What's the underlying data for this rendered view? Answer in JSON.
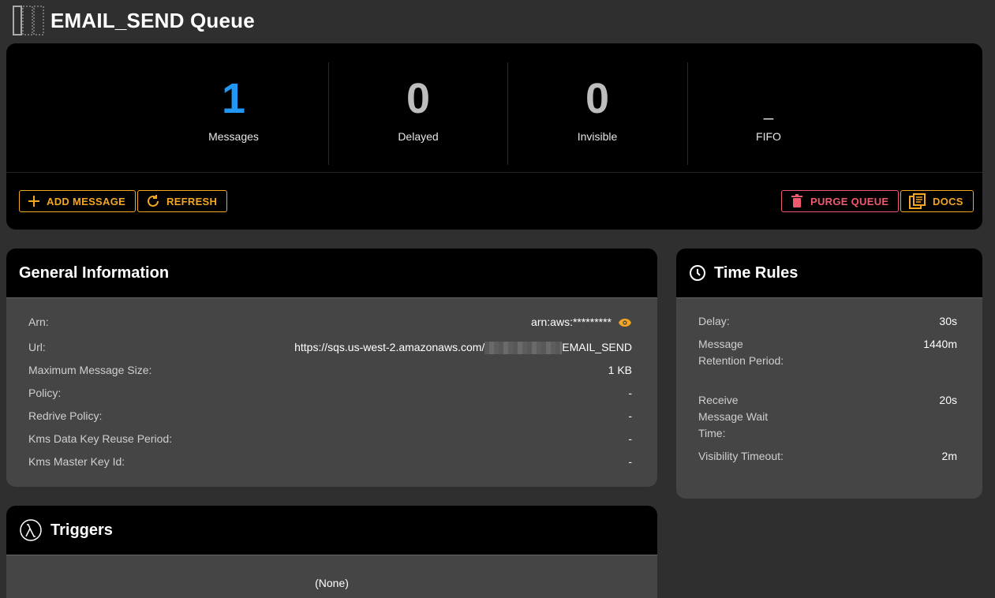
{
  "header": {
    "title": "EMAIL_SEND Queue",
    "icon": "queue-icon"
  },
  "stats": {
    "messages": {
      "value": "1",
      "label": "Messages"
    },
    "delayed": {
      "value": "0",
      "label": "Delayed"
    },
    "invisible": {
      "value": "0",
      "label": "Invisible"
    },
    "fifo": {
      "value": "_",
      "label": "FIFO"
    }
  },
  "actions": {
    "add_message": "ADD MESSAGE",
    "refresh": "REFRESH",
    "purge_queue": "PURGE QUEUE",
    "docs": "DOCS"
  },
  "general": {
    "title": "General Information",
    "rows": [
      {
        "label": "Arn:",
        "value": "arn:aws:*********"
      },
      {
        "label": "Url:",
        "value_prefix": "https://sqs.us-west-2.amazonaws.com/",
        "value_suffix": "EMAIL_SEND"
      },
      {
        "label": "Maximum Message Size:",
        "value": "1 KB"
      },
      {
        "label": "Policy:",
        "value": "-"
      },
      {
        "label": "Redrive Policy:",
        "value": "-"
      },
      {
        "label": "Kms Data Key Reuse Period:",
        "value": "-"
      },
      {
        "label": "Kms Master Key Id:",
        "value": "-"
      }
    ]
  },
  "time_rules": {
    "title": "Time Rules",
    "rows": [
      {
        "label": "Delay:",
        "value": "30s"
      },
      {
        "label": "Message Retention Period:",
        "value": "1440m"
      },
      {
        "label": "Receive Message Wait Time:",
        "value": "20s"
      },
      {
        "label": "Visibility Timeout:",
        "value": "2m"
      }
    ]
  },
  "triggers": {
    "title": "Triggers",
    "empty": "(None)"
  },
  "colors": {
    "accent": "#f5a623",
    "danger": "#ef5a6f",
    "primary": "#2196f3"
  }
}
